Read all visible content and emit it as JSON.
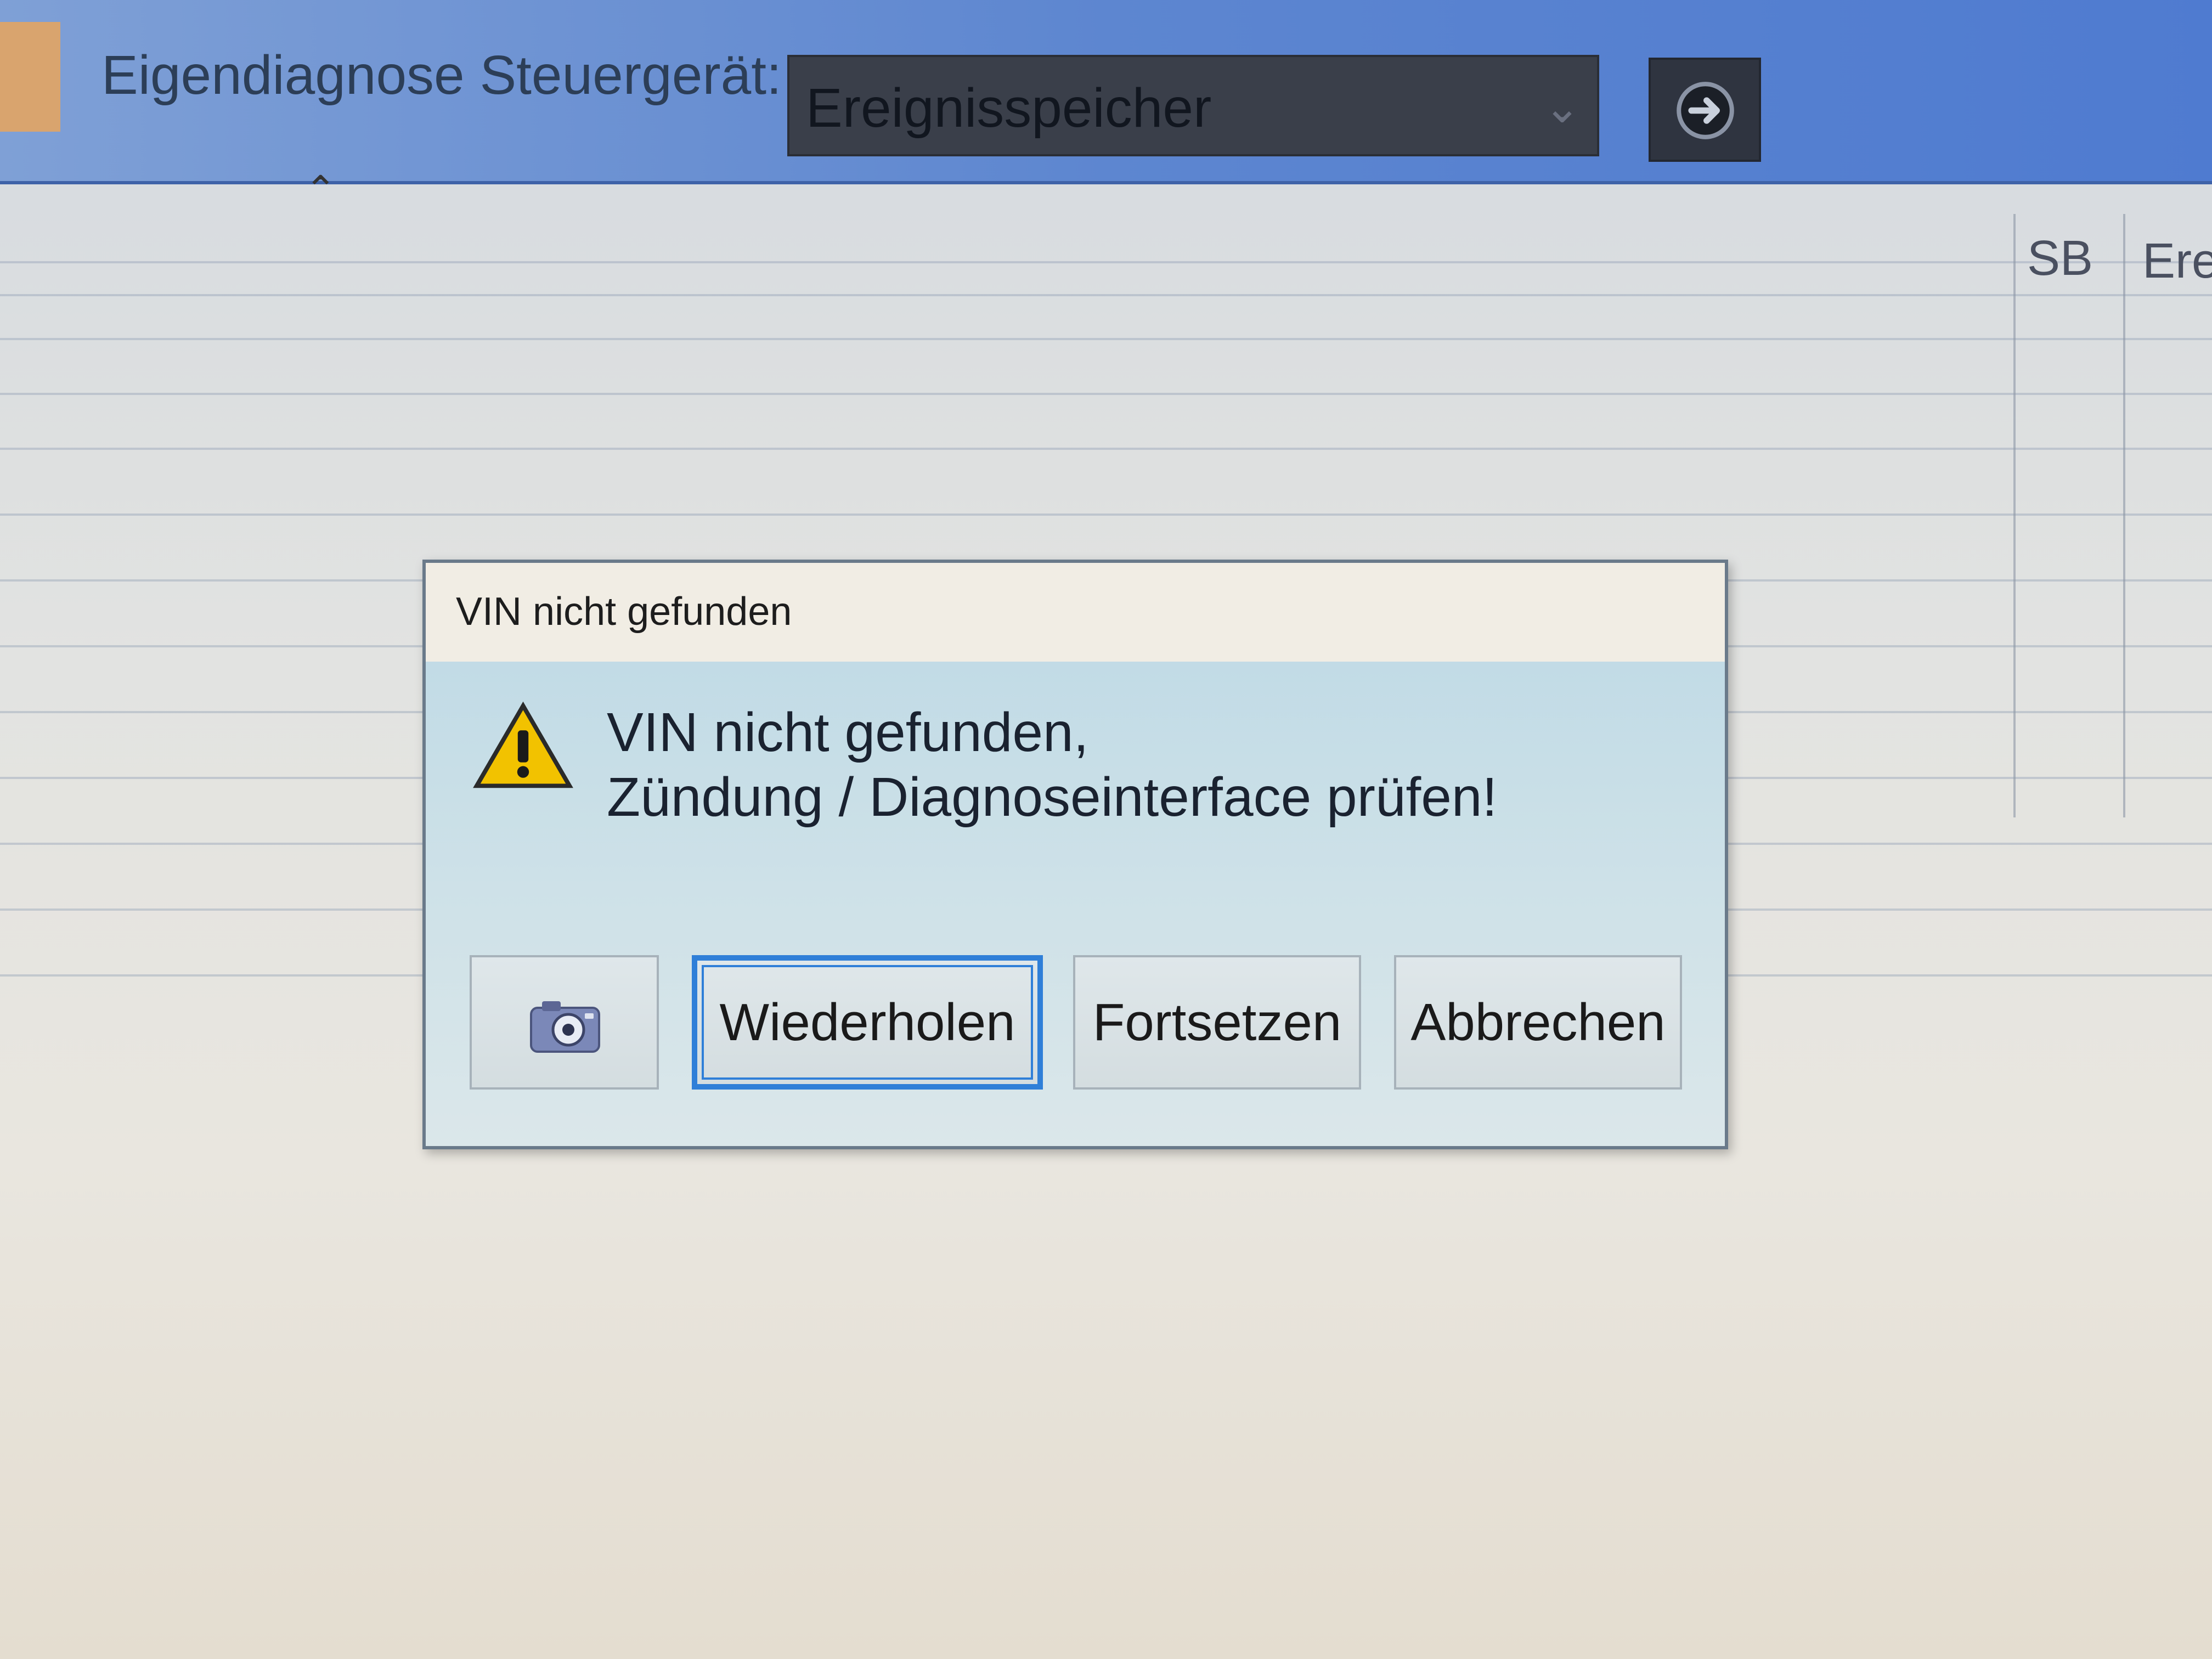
{
  "toolbar": {
    "label": "Eigendiagnose Steuergerät:",
    "event_select": {
      "selected_value": "Ereignisspeicher"
    },
    "go_button_icon": "arrow-right-circle-icon",
    "caret_icon": "chevron-up-icon"
  },
  "table": {
    "columns": [
      "SB",
      "Ere"
    ]
  },
  "dialog": {
    "title": "VIN nicht gefunden",
    "icon": "warning-icon",
    "message_lines": [
      "VIN nicht gefunden,",
      "Zündung / Diagnoseinterface prüfen!"
    ],
    "buttons": {
      "screenshot_icon": "camera-icon",
      "retry": "Wiederholen",
      "continue": "Fortsetzen",
      "cancel": "Abbrechen"
    }
  },
  "colors": {
    "toolbar_blue": "#5d86d0",
    "select_dark": "#3a3f4a",
    "dialog_bg": "#c9dfe7",
    "focus_blue": "#2f7fd8",
    "warning_yellow": "#f2c200"
  }
}
